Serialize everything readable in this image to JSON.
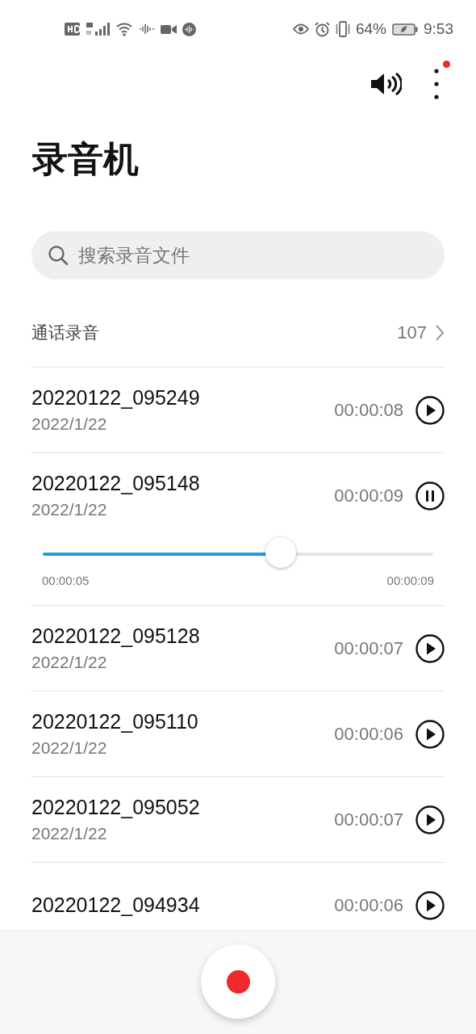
{
  "status_bar": {
    "battery": "64%",
    "time": "9:53"
  },
  "toolbar": {
    "notification_dot": true
  },
  "title": "录音机",
  "search": {
    "placeholder": "搜索录音文件"
  },
  "call_recordings": {
    "label": "通话录音",
    "count": "107"
  },
  "recordings": [
    {
      "name": "20220122_095249",
      "date": "2022/1/22",
      "duration": "00:00:08",
      "playing": false
    },
    {
      "name": "20220122_095148",
      "date": "2022/1/22",
      "duration": "00:00:09",
      "playing": true,
      "player": {
        "level": 0.61,
        "elapsed": "00:00:05",
        "total": "00:00:09"
      }
    },
    {
      "name": "20220122_095128",
      "date": "2022/1/22",
      "duration": "00:00:07",
      "playing": false
    },
    {
      "name": "20220122_095110",
      "date": "2022/1/22",
      "duration": "00:00:06",
      "playing": false
    },
    {
      "name": "20220122_095052",
      "date": "2022/1/22",
      "duration": "00:00:07",
      "playing": false
    },
    {
      "name": "20220122_094934",
      "duration": "00:00:06",
      "playing": false
    }
  ]
}
